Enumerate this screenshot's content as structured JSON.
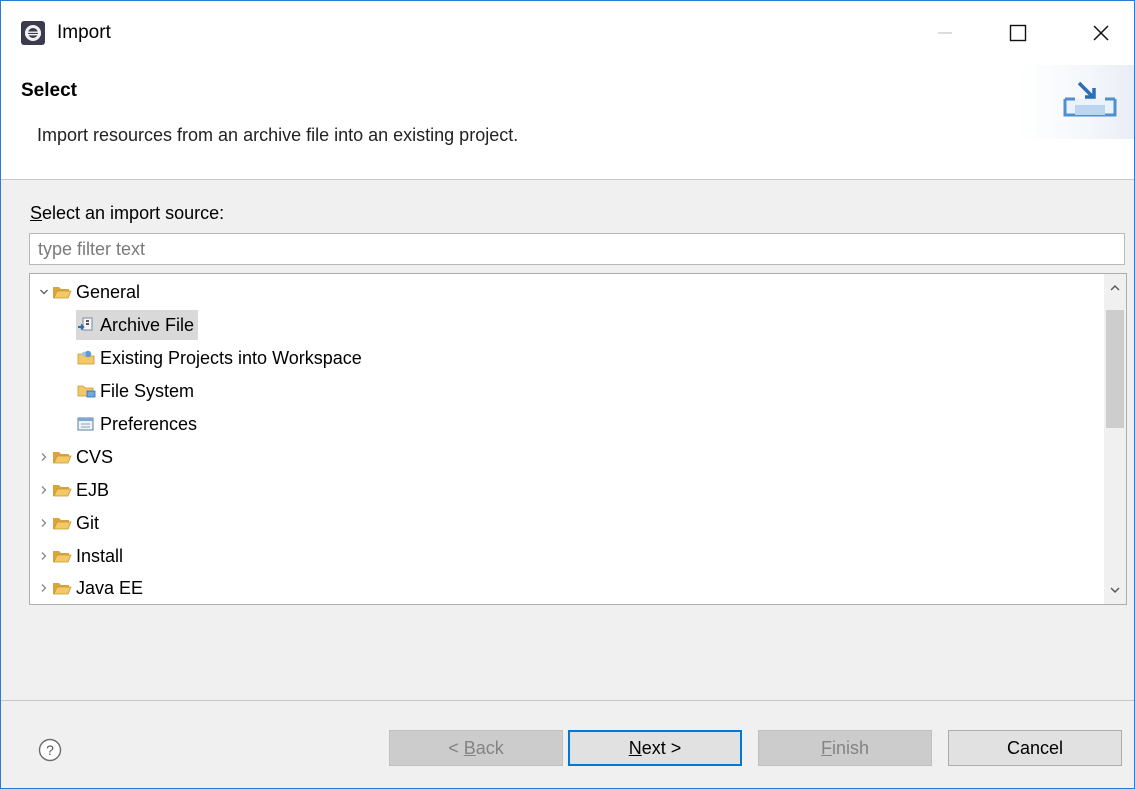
{
  "window": {
    "title": "Import",
    "controls": {
      "minimize": "—",
      "maximize": "□",
      "close": "✕"
    }
  },
  "header": {
    "title": "Select",
    "description": "Import resources from an archive file into an existing project.",
    "image_icon": "import-wizard-icon"
  },
  "source": {
    "label_mnemonic": "S",
    "label_rest": "elect an import source:",
    "filter_placeholder": "type filter text",
    "filter_value": ""
  },
  "tree": {
    "items": [
      {
        "label": "General",
        "expanded": true,
        "icon": "folder-open-icon"
      },
      {
        "label": "Archive File",
        "icon": "archive-file-icon",
        "selected": true,
        "parent": "General"
      },
      {
        "label": "Existing Projects into Workspace",
        "icon": "existing-projects-icon",
        "parent": "General"
      },
      {
        "label": "File System",
        "icon": "file-system-icon",
        "parent": "General"
      },
      {
        "label": "Preferences",
        "icon": "preferences-icon",
        "parent": "General"
      },
      {
        "label": "CVS",
        "expanded": false,
        "icon": "folder-icon"
      },
      {
        "label": "EJB",
        "expanded": false,
        "icon": "folder-icon"
      },
      {
        "label": "Git",
        "expanded": false,
        "icon": "folder-icon"
      },
      {
        "label": "Install",
        "expanded": false,
        "icon": "folder-icon"
      },
      {
        "label": "Java EE",
        "expanded": false,
        "icon": "folder-icon"
      }
    ]
  },
  "buttons": {
    "back": {
      "prefix": "< ",
      "mnemonic": "B",
      "rest": "ack",
      "enabled": false
    },
    "next": {
      "mnemonic": "N",
      "rest": "ext >",
      "enabled": true
    },
    "finish": {
      "mnemonic": "F",
      "rest": "inish",
      "enabled": false
    },
    "cancel": {
      "label": "Cancel",
      "enabled": true
    }
  },
  "colors": {
    "accent": "#0078d7",
    "window_border": "#2b7bd2",
    "selection": "#d9d9d9",
    "folder": "#e8b84c"
  }
}
